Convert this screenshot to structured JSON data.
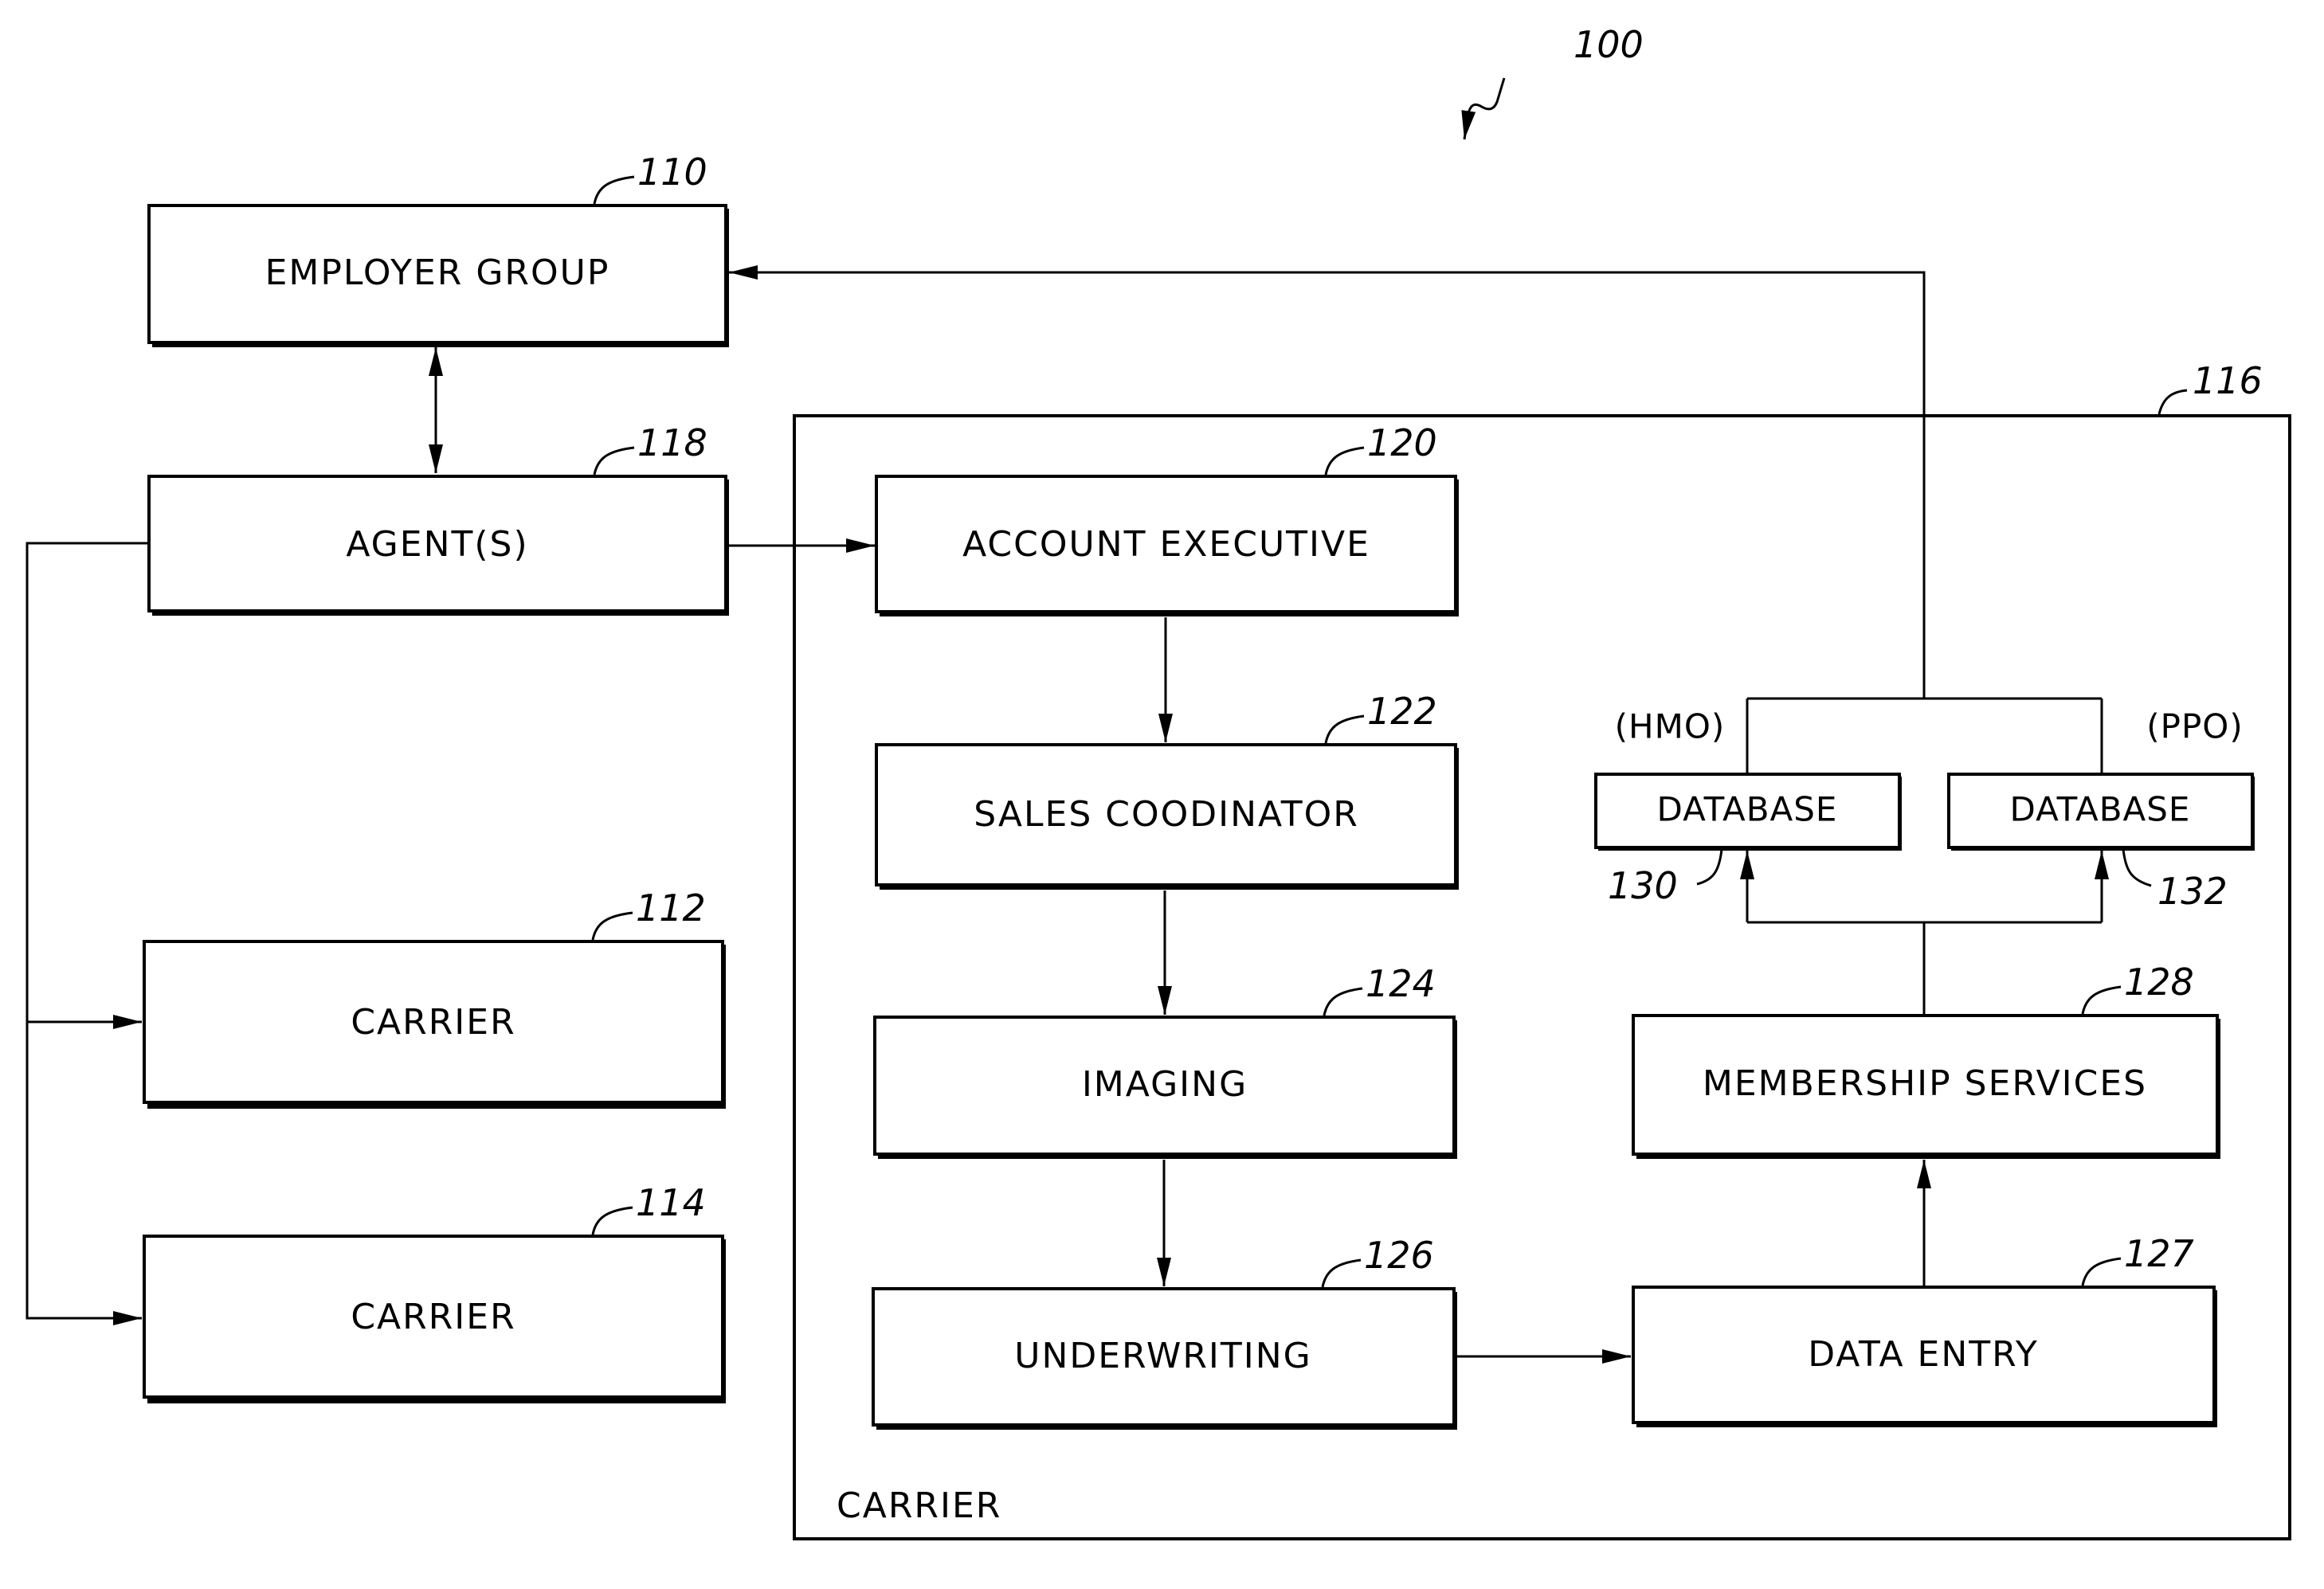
{
  "figure": {
    "ref": "100"
  },
  "blocks": {
    "employer_group": {
      "label": "EMPLOYER GROUP",
      "ref": "110"
    },
    "agents": {
      "label": "AGENT(S)",
      "ref": "118"
    },
    "carrier_112": {
      "label": "CARRIER",
      "ref": "112"
    },
    "carrier_114": {
      "label": "CARRIER",
      "ref": "114"
    },
    "carrier_container": {
      "label": "CARRIER",
      "ref": "116"
    },
    "account_executive": {
      "label": "ACCOUNT EXECUTIVE",
      "ref": "120"
    },
    "sales_coordinator": {
      "label": "SALES COODINATOR",
      "ref": "122"
    },
    "imaging": {
      "label": "IMAGING",
      "ref": "124"
    },
    "underwriting": {
      "label": "UNDERWRITING",
      "ref": "126"
    },
    "data_entry": {
      "label": "DATA ENTRY",
      "ref": "127"
    },
    "membership_services": {
      "label": "MEMBERSHIP SERVICES",
      "ref": "128"
    },
    "database_hmo": {
      "label": "DATABASE",
      "qualifier": "(HMO)",
      "ref": "130"
    },
    "database_ppo": {
      "label": "DATABASE",
      "qualifier": "(PPO)",
      "ref": "132"
    }
  },
  "connections": [
    {
      "from": "employer_group",
      "to": "agents",
      "type": "bidirectional"
    },
    {
      "from": "agents",
      "to": "account_executive",
      "type": "arrow"
    },
    {
      "from": "agents",
      "to": "carrier_112",
      "type": "arrow"
    },
    {
      "from": "agents",
      "to": "carrier_114",
      "type": "arrow"
    },
    {
      "from": "account_executive",
      "to": "sales_coordinator",
      "type": "arrow"
    },
    {
      "from": "sales_coordinator",
      "to": "imaging",
      "type": "arrow"
    },
    {
      "from": "imaging",
      "to": "underwriting",
      "type": "arrow"
    },
    {
      "from": "underwriting",
      "to": "data_entry",
      "type": "arrow"
    },
    {
      "from": "data_entry",
      "to": "membership_services",
      "type": "arrow"
    },
    {
      "from": "membership_services",
      "to": "database_hmo",
      "type": "arrow"
    },
    {
      "from": "membership_services",
      "to": "database_ppo",
      "type": "arrow"
    },
    {
      "from": "database_hmo",
      "to": "employer_group",
      "type": "arrow"
    },
    {
      "from": "database_ppo",
      "to": "employer_group",
      "type": "arrow"
    }
  ]
}
